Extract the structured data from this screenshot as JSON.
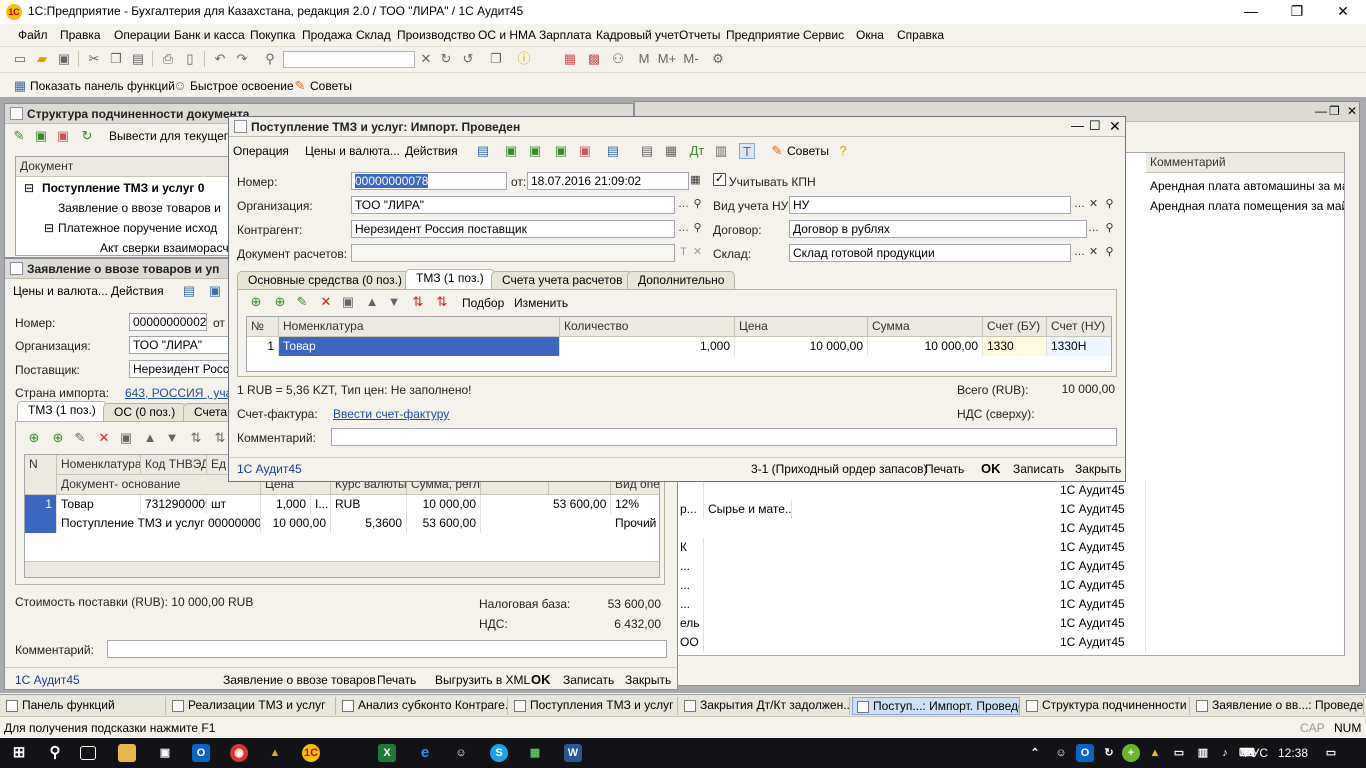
{
  "app": {
    "title": "1С:Предприятие - Бухгалтерия для Казахстана, редакция 2.0 / ТОО \"ЛИРА\" / 1С Аудит45",
    "min": "—",
    "max": "❐",
    "close": "✕"
  },
  "menu": [
    "Файл",
    "Правка",
    "Операции",
    "Банк и касса",
    "Покупка",
    "Продажа",
    "Склад",
    "Производство",
    "ОС и НМА",
    "Зарплата",
    "Кадровый учет",
    "Отчеты",
    "Предприятие",
    "Сервис",
    "Окна",
    "Справка"
  ],
  "toolbar2": {
    "show_panel": "Показать панель функций",
    "quick": "Быстрое освоение",
    "tips": "Советы"
  },
  "win_structure": {
    "title": "Структура подчиненности документа",
    "output_btn": "Вывести для текущего",
    "col_doc": "Документ",
    "rows": [
      "Поступление ТМЗ и услуг 0",
      "Заявление о ввозе товаров и",
      "Платежное поручение исход",
      "Акт сверки взаиморасче"
    ]
  },
  "win_statement": {
    "title": "Заявление о ввозе товаров и уп",
    "menu": {
      "prices": "Цены и валюта...",
      "actions": "Действия"
    },
    "number_label": "Номер:",
    "number": "00000000002",
    "from_label": "от",
    "org_label": "Организация:",
    "org": "ТОО \"ЛИРА\"",
    "supplier_label": "Поставщик:",
    "supplier": "Нерезидент Росси",
    "country_label": "Страна импорта:",
    "country": "643, РОССИЯ , участ",
    "tabs": [
      "ТМЗ (1 поз.)",
      "ОС (0 поз.)",
      "Счета"
    ],
    "grid_headers": [
      "N",
      "Номенклатура",
      "Код ТНВЭД",
      "Ед",
      "Цена",
      "Курс валюты",
      "Сумма, регл.",
      "",
      "",
      "Вид опер"
    ],
    "grid_subheader": "Документ- основание",
    "row": {
      "n": "1",
      "nom": "Товар",
      "code": "7312900009",
      "unit": "шт",
      "qty": "1,000",
      "i": "I...",
      "cur": "RUB",
      "sum": "10 000,00",
      "amount": "53 600,00",
      "rate": "12%"
    },
    "row2": {
      "doc": "Поступление ТМЗ и услуг 000000000...",
      "price": "10 000,00",
      "course": "5,3600",
      "sumregl": "53 600,00",
      "kind": "Прочий"
    },
    "cost_label": "Стоимость поставки (RUB): 10 000,00 RUB",
    "taxbase_label": "Налоговая база:",
    "taxbase": "53 600,00",
    "vat_label": "НДС:",
    "vat": "6 432,00",
    "comment_label": "Комментарий:",
    "footer": {
      "user": "1С Аудит45",
      "doc": "Заявление о ввозе товаров",
      "print": "Печать",
      "xml": "Выгрузить в XML",
      "ok": "OK",
      "save": "Записать",
      "close": "Закрыть"
    }
  },
  "win_right": {
    "header_comment": "Комментарий",
    "comments": [
      "Арендная плата автомашины за май",
      "Арендная плата помещения за май"
    ],
    "rows": [
      {
        "a": "",
        "b": "",
        "c": "1С Аудит45"
      },
      {
        "a": "р...",
        "b": "Сырье и мате...",
        "c": "1С Аудит45"
      },
      {
        "a": "",
        "b": "",
        "c": "1С Аудит45"
      },
      {
        "a": "К",
        "b": "",
        "c": "1С Аудит45"
      },
      {
        "a": "...",
        "b": "",
        "c": "1С Аудит45"
      },
      {
        "a": "...",
        "b": "",
        "c": "1С Аудит45"
      },
      {
        "a": "...",
        "b": "",
        "c": "1С Аудит45"
      },
      {
        "a": "ель",
        "b": "",
        "c": "1С Аудит45"
      },
      {
        "a": "ОО",
        "b": "",
        "c": "1С Аудит45"
      }
    ]
  },
  "win_receipt": {
    "title": "Поступление ТМЗ и услуг: Импорт. Проведен",
    "menu": {
      "operation": "Операция",
      "prices": "Цены и валюта...",
      "actions": "Действия",
      "tips": "Советы"
    },
    "number_label": "Номер:",
    "number": "00000000078",
    "from_label": "от:",
    "date": "18.07.2016 21:09:02",
    "kpn_label": "Учитывать КПН",
    "org_label": "Организация:",
    "org": "ТОО \"ЛИРА\"",
    "nu_label": "Вид учета НУ:",
    "nu": "НУ",
    "contr_label": "Контрагент:",
    "contr": "Нерезидент Россия поставщик",
    "contract_label": "Договор:",
    "contract": "Договор в рублях",
    "docpay_label": "Документ расчетов:",
    "warehouse_label": "Склад:",
    "warehouse": "Склад готовой продукции",
    "tabs": [
      "Основные средства (0 поз.)",
      "ТМЗ (1 поз.)",
      "Счета учета расчетов",
      "Дополнительно"
    ],
    "grid_toolbar": {
      "pick": "Подбор",
      "change": "Изменить"
    },
    "grid_headers": [
      "№",
      "Номенклатура",
      "Количество",
      "Цена",
      "Сумма",
      "Счет (БУ)",
      "Счет (НУ)"
    ],
    "row": {
      "n": "1",
      "nom": "Товар",
      "qty": "1,000",
      "price": "10 000,00",
      "sum": "10 000,00",
      "bu": "1330",
      "nu": "1330Н"
    },
    "rate_info": "1 RUB = 5,36 KZT, Тип цен: Не заполнено!",
    "total_label": "Всего (RUB):",
    "total": "10 000,00",
    "invoice_label": "Счет-фактура:",
    "invoice_link": "Ввести счет-фактуру",
    "vat_label": "НДС (сверху):",
    "comment_label": "Комментарий:",
    "footer": {
      "user": "1С Аудит45",
      "order": "3-1 (Приходный ордер запасов)",
      "print": "Печать",
      "ok": "OK",
      "save": "Записать",
      "close": "Закрыть"
    }
  },
  "windows_bar": [
    "Панель функций",
    "Реализации ТМЗ и услуг",
    "Анализ субконто Контраге...",
    "Поступления ТМЗ и услуг",
    "Закрытия Дт/Кт задолжен...",
    "Поступ...: Импорт. Проведен",
    "Структура подчиненности ...",
    "Заявление о вв...: Проведен"
  ],
  "status": {
    "hint": "Для получения подсказки нажмите F1",
    "cap": "CAP",
    "num": "NUM"
  },
  "os": {
    "lang": "РУС",
    "time": "12:38"
  }
}
